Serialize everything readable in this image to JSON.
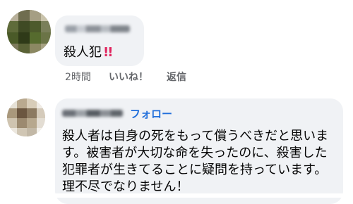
{
  "comments": [
    {
      "text": "殺人犯",
      "emphasis": "!!",
      "actions": {
        "time": "2時間",
        "like": "いいね！",
        "reply": "返信"
      }
    },
    {
      "follow_label": "フォロー",
      "lines": [
        "殺人者は自身の死をもって償うべきだと思いま",
        "す。被害者が大切な命を失ったのに、殺害した",
        "犯罪者が生きてることに疑問を持っています。",
        "理不尽でなりません！"
      ]
    }
  ],
  "colors": {
    "bubble": "#f0f2f5",
    "link": "#216fdb",
    "meta": "#65676b",
    "emphasis": "#e0245e"
  }
}
